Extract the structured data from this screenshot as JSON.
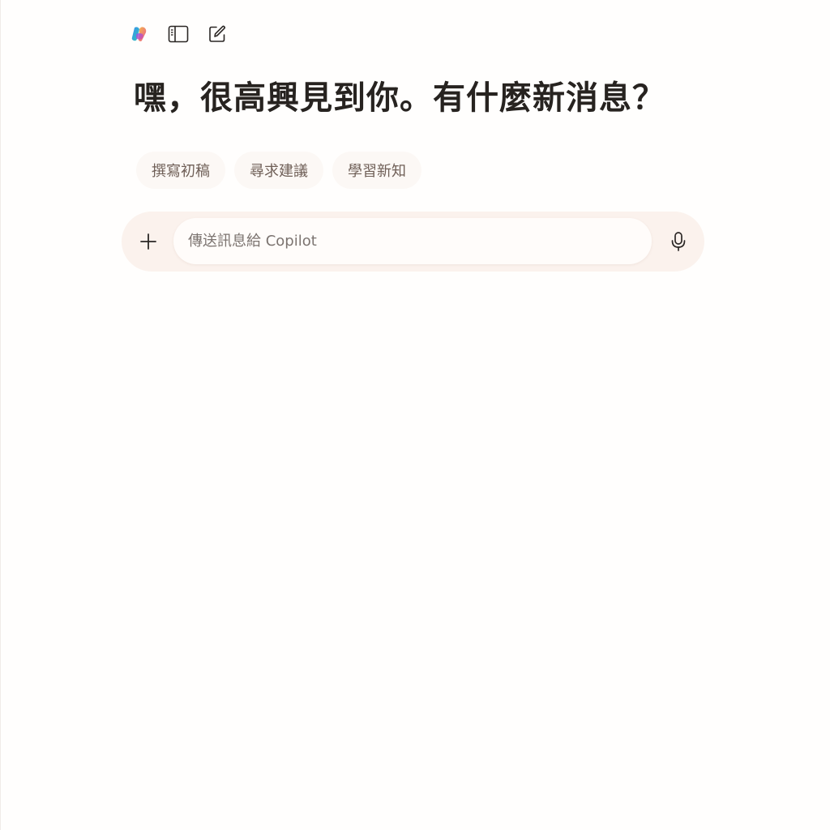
{
  "toolbar": {
    "icons": [
      "copilot-logo-icon",
      "sidebar-toggle-icon",
      "new-chat-icon"
    ]
  },
  "greeting": {
    "text": "嘿，很高興見到你。有什麼新消息？"
  },
  "suggestions": [
    {
      "label": "撰寫初稿"
    },
    {
      "label": "尋求建議"
    },
    {
      "label": "學習新知"
    }
  ],
  "composer": {
    "placeholder": "傳送訊息給 Copilot",
    "value": "",
    "add_icon": "plus-icon",
    "mic_icon": "microphone-icon"
  },
  "colors": {
    "background": "#fffefd",
    "heading_text": "#272320",
    "chip_background": "#fcf8f5",
    "chip_text": "#6f5f57",
    "composer_background": "#fbf2ed",
    "input_background": "#fffcfa"
  }
}
